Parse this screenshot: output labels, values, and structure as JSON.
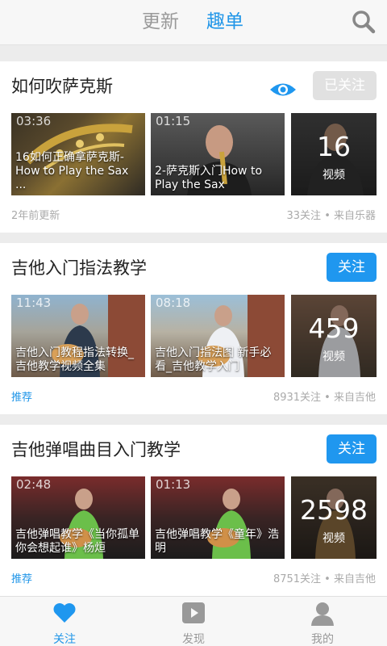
{
  "header": {
    "tabs": [
      "更新",
      "趣单"
    ],
    "active_tab": "趣单",
    "accent": "#2196e8",
    "search_icon": "search-icon"
  },
  "cards": [
    {
      "title": "如何吹萨克斯",
      "follow_label": "已关注",
      "followed": true,
      "videos": [
        {
          "duration": "03:36",
          "caption": "16如何正确拿萨克斯-How to Play the Sax ..."
        },
        {
          "duration": "01:15",
          "caption": "2-萨克斯入门How to Play the Sax"
        }
      ],
      "count": "16",
      "count_label": "视频",
      "updated": "2年前更新",
      "meta": "33关注 • 来自乐器"
    },
    {
      "title": "吉他入门指法教学",
      "follow_label": "关注",
      "followed": false,
      "videos": [
        {
          "duration": "11:43",
          "caption": "吉他入门教程指法转换_吉他教学视频全集"
        },
        {
          "duration": "08:18",
          "caption": "吉他入门指法图 新手必看_吉他教学入门"
        }
      ],
      "count": "459",
      "count_label": "视频",
      "tag": "推荐",
      "meta": "8931关注 • 来自吉他"
    },
    {
      "title": "吉他弹唱曲目入门教学",
      "follow_label": "关注",
      "followed": false,
      "videos": [
        {
          "duration": "02:48",
          "caption": "吉他弹唱教学《当你孤单你会想起谁》杨烜"
        },
        {
          "duration": "01:13",
          "caption": "吉他弹唱教学《童年》浩明"
        }
      ],
      "count": "2598",
      "count_label": "视频",
      "tag": "推荐",
      "meta": "8751关注 • 来自吉他"
    }
  ],
  "nav": [
    {
      "label": "关注",
      "icon": "heart-icon",
      "active": true
    },
    {
      "label": "发现",
      "icon": "play-icon",
      "active": false
    },
    {
      "label": "我的",
      "icon": "user-icon",
      "active": false
    }
  ]
}
